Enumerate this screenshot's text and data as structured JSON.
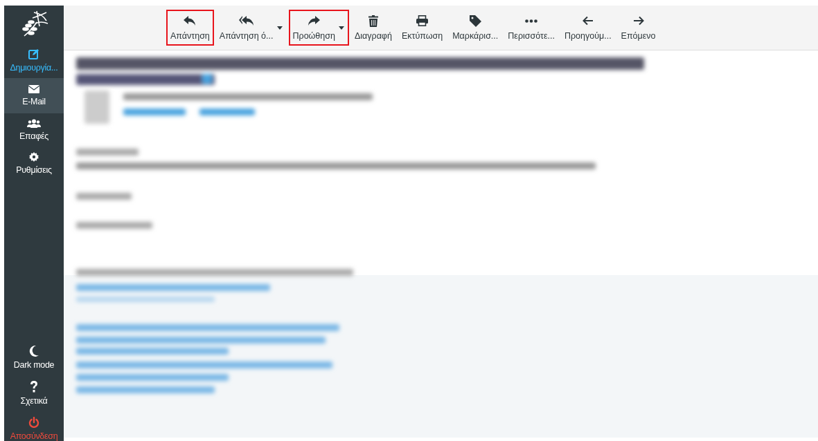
{
  "sidebar": {
    "items": [
      {
        "kind": "compose",
        "label": "Δημιουργία...",
        "selected": false
      },
      {
        "kind": "mail",
        "label": "E-Mail",
        "selected": true
      },
      {
        "kind": "contacts",
        "label": "Επαφές",
        "selected": false
      },
      {
        "kind": "settings",
        "label": "Ρυθμίσεις",
        "selected": false
      }
    ],
    "bottom_items": [
      {
        "kind": "moon",
        "label": "Dark mode"
      },
      {
        "kind": "help",
        "label": "Σχετικά"
      },
      {
        "kind": "logout",
        "label": "Αποσύνδεση"
      }
    ]
  },
  "toolbar": {
    "buttons": [
      {
        "kind": "reply",
        "label": "Απάντηση",
        "has_menu": false,
        "highlighted": true
      },
      {
        "kind": "reply-all",
        "label": "Απάντηση ό...",
        "has_menu": true,
        "highlighted": false
      },
      {
        "kind": "forward",
        "label": "Προώθηση",
        "has_menu": true,
        "highlighted": true
      },
      {
        "kind": "delete",
        "label": "Διαγραφή",
        "has_menu": false,
        "highlighted": false
      },
      {
        "kind": "print",
        "label": "Εκτύπωση",
        "has_menu": false,
        "highlighted": false
      },
      {
        "kind": "tag",
        "label": "Μαρκάρισ...",
        "has_menu": false,
        "highlighted": false
      },
      {
        "kind": "more",
        "label": "Περισσότε...",
        "has_menu": false,
        "highlighted": false
      },
      {
        "kind": "prev",
        "label": "Προηγούμ...",
        "has_menu": false,
        "highlighted": false
      },
      {
        "kind": "next",
        "label": "Επόμενο",
        "has_menu": false,
        "highlighted": false
      }
    ]
  }
}
